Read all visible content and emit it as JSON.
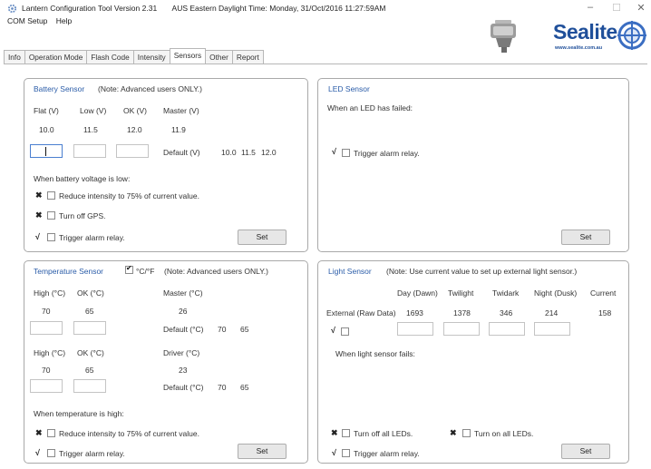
{
  "window": {
    "title": "Lantern Configuration Tool Version 2.31",
    "time_text": "AUS Eastern Daylight Time: Monday, 31/Oct/2016 11:27:59AM",
    "minimize": "–",
    "maximize": "☐",
    "close": "✕"
  },
  "menu": {
    "com_setup": "COM Setup",
    "help": "Help"
  },
  "logo": {
    "text": "Sealite",
    "url": "www.sealite.com.au"
  },
  "tabs": [
    "Info",
    "Operation Mode",
    "Flash Code",
    "Intensity",
    "Sensors",
    "Other",
    "Report"
  ],
  "battery": {
    "title": "Battery Sensor",
    "note": "(Note: Advanced users ONLY.)",
    "headers": [
      "Flat (V)",
      "Low (V)",
      "OK (V)",
      "Master (V)"
    ],
    "values": [
      "10.0",
      "11.5",
      "12.0",
      "11.9"
    ],
    "default_label": "Default (V)",
    "defaults": [
      "10.0",
      "11.5",
      "12.0"
    ],
    "low_label": "When battery voltage is low:",
    "opt1_mark": "✖",
    "opt1": "Reduce intensity to 75% of current value.",
    "opt2_mark": "✖",
    "opt2": "Turn off GPS.",
    "opt3_mark": "√",
    "opt3": "Trigger alarm relay.",
    "set": "Set"
  },
  "led": {
    "title": "LED Sensor",
    "failed_label": "When an LED has failed:",
    "opt_mark": "√",
    "opt": "Trigger alarm relay.",
    "set": "Set"
  },
  "temperature": {
    "title": "Temperature Sensor",
    "unit_toggle": "°C/°F",
    "note": "(Note: Advanced users ONLY.)",
    "h1": [
      "High (°C)",
      "OK (°C)"
    ],
    "v1": [
      "70",
      "65"
    ],
    "master_label": "Master (°C)",
    "master_value": "26",
    "default_label": "Default (°C)",
    "defaults1": [
      "70",
      "65"
    ],
    "h2": [
      "High (°C)",
      "OK (°C)"
    ],
    "v2": [
      "70",
      "65"
    ],
    "driver_label": "Driver (°C)",
    "driver_value": "23",
    "defaults2": [
      "70",
      "65"
    ],
    "high_label": "When temperature is high:",
    "opt1_mark": "✖",
    "opt1": "Reduce intensity to 75% of current value.",
    "opt2_mark": "√",
    "opt2": "Trigger alarm relay.",
    "set": "Set"
  },
  "light": {
    "title": "Light Sensor",
    "note": "(Note: Use current value to set up external light sensor.)",
    "headers": [
      "Day (Dawn)",
      "Twilight",
      "Twidark",
      "Night (Dusk)",
      "Current"
    ],
    "row_label": "External (Raw Data)",
    "values": [
      "1693",
      "1378",
      "346",
      "214",
      "158"
    ],
    "ext_mark": "√",
    "fails_label": "When light sensor fails:",
    "opt1_mark": "✖",
    "opt1": "Turn off all LEDs.",
    "opt2_mark": "✖",
    "opt2": "Turn on all LEDs.",
    "opt3_mark": "√",
    "opt3": "Trigger alarm relay.",
    "set": "Set"
  }
}
